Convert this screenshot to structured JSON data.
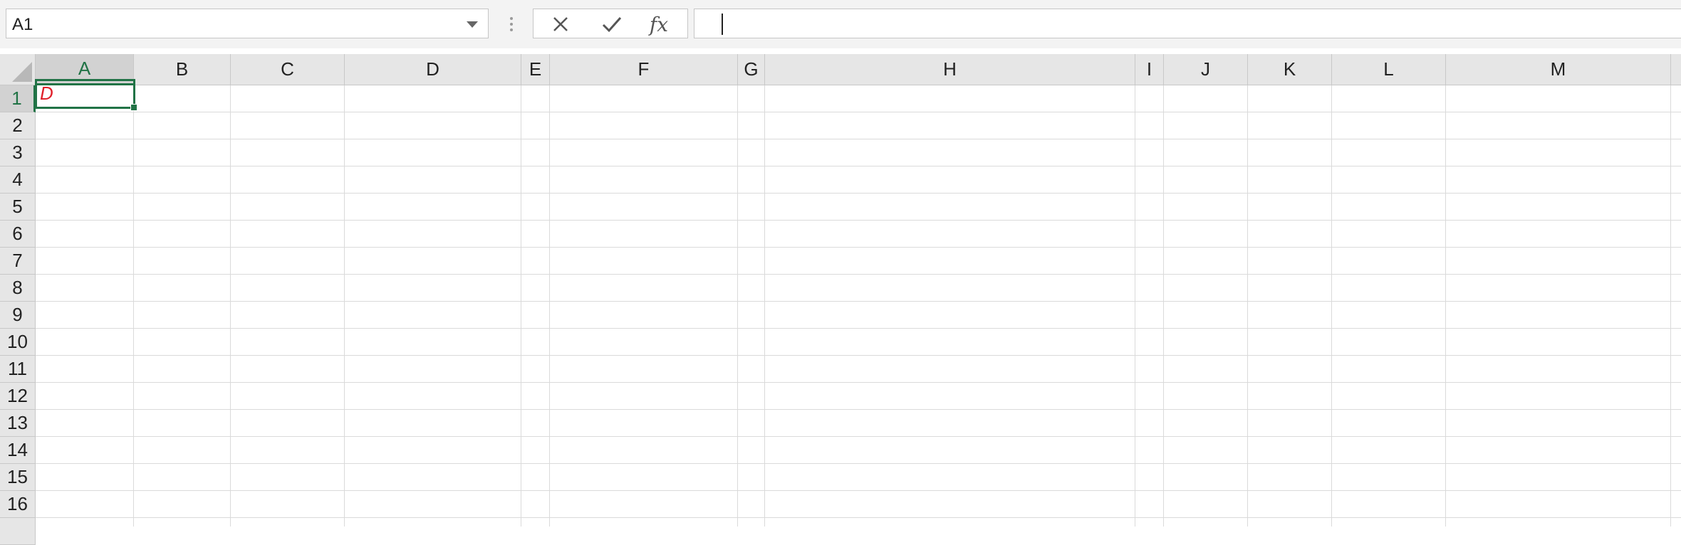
{
  "name_box": {
    "value": "A1"
  },
  "formula_bar": {
    "cancel_icon": "close-icon",
    "enter_icon": "checkmark-icon",
    "function_label": "fx",
    "formula_value": ""
  },
  "columns": [
    "A",
    "B",
    "C",
    "D",
    "E",
    "F",
    "G",
    "H",
    "I",
    "J",
    "K",
    "L",
    "M"
  ],
  "rows": [
    "1",
    "2",
    "3",
    "4",
    "5",
    "6",
    "7",
    "8",
    "9",
    "10",
    "11",
    "12",
    "13",
    "14",
    "15",
    "16"
  ],
  "selected_cell": "A1",
  "cells": {
    "A1": {
      "value": "D",
      "color": "#e0202a",
      "italic": true
    }
  },
  "colors": {
    "accent": "#217346",
    "header_bg": "#e6e6e6",
    "gridline": "#dadada"
  }
}
